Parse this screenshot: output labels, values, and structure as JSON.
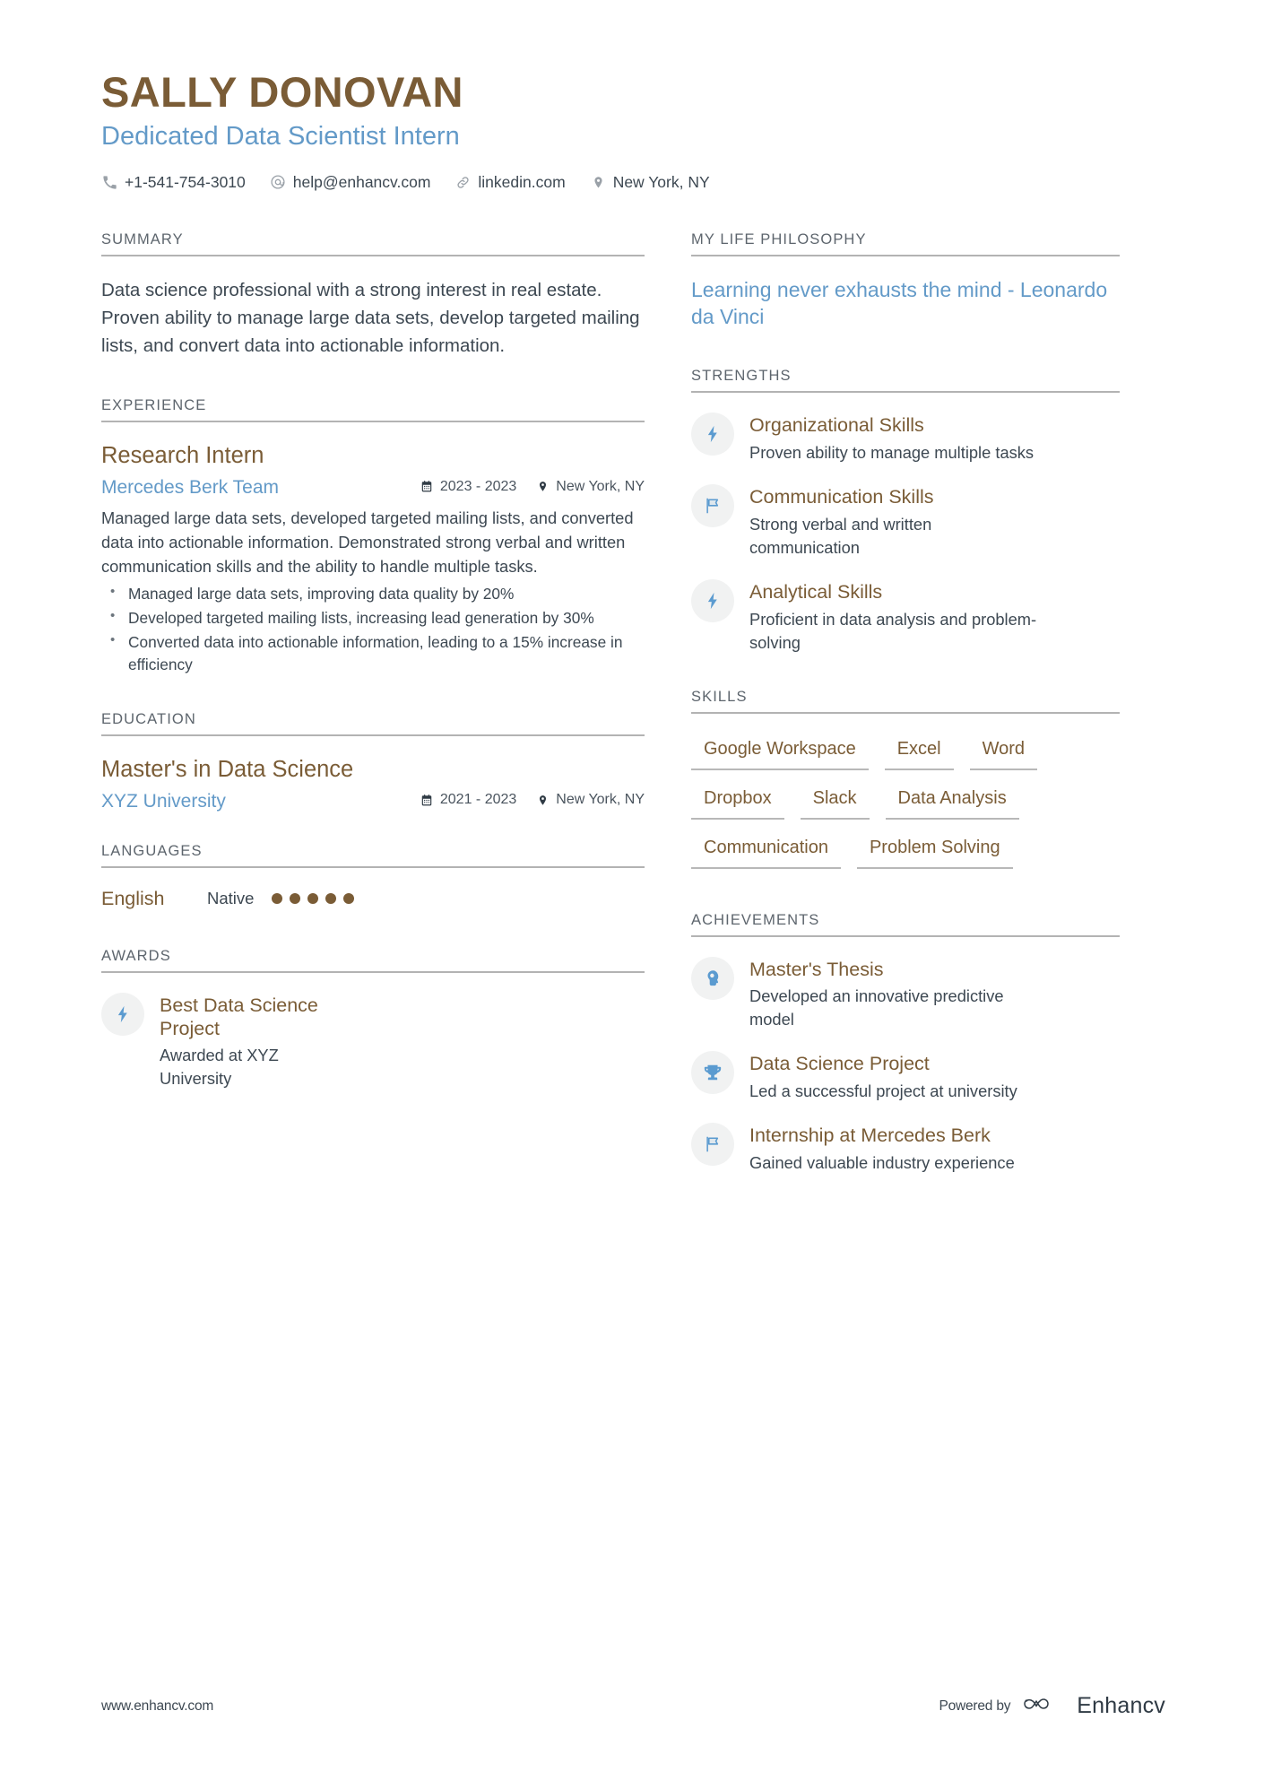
{
  "header": {
    "name": "SALLY DONOVAN",
    "title": "Dedicated Data Scientist Intern",
    "contacts": [
      {
        "icon": "phone-icon",
        "text": "+1-541-754-3010"
      },
      {
        "icon": "email-icon",
        "text": "help@enhancv.com"
      },
      {
        "icon": "link-icon",
        "text": "linkedin.com"
      },
      {
        "icon": "location-pin-icon",
        "text": "New York, NY"
      }
    ]
  },
  "summary": {
    "heading": "SUMMARY",
    "text": "Data science professional with a strong interest in real estate. Proven ability to manage large data sets, develop targeted mailing lists, and convert data into actionable information."
  },
  "experience": {
    "heading": "EXPERIENCE",
    "entries": [
      {
        "title": "Research Intern",
        "organization": "Mercedes Berk Team",
        "date": "2023 - 2023",
        "location": "New York, NY",
        "description": "Managed large data sets, developed targeted mailing lists, and converted data into actionable information. Demonstrated strong verbal and written communication skills and the ability to handle multiple tasks.",
        "bullets": [
          "Managed large data sets, improving data quality by 20%",
          "Developed targeted mailing lists, increasing lead generation by 30%",
          "Converted data into actionable information, leading to a 15% increase in efficiency"
        ]
      }
    ]
  },
  "education": {
    "heading": "EDUCATION",
    "entries": [
      {
        "title": "Master's in Data Science",
        "organization": "XYZ University",
        "date": "2021 - 2023",
        "location": "New York, NY"
      }
    ]
  },
  "languages": {
    "heading": "LANGUAGES",
    "items": [
      {
        "name": "English",
        "level": "Native",
        "filled": 5,
        "total": 5
      }
    ]
  },
  "awards": {
    "heading": "AWARDS",
    "items": [
      {
        "icon": "lightning-bolt-icon",
        "title": "Best Data Science Project",
        "description": "Awarded at XYZ University"
      }
    ]
  },
  "philosophy": {
    "heading": "MY LIFE PHILOSOPHY",
    "quote": "Learning never exhausts the mind - Leonardo da Vinci"
  },
  "strengths": {
    "heading": "STRENGTHS",
    "items": [
      {
        "icon": "lightning-bolt-icon",
        "title": "Organizational Skills",
        "description": "Proven ability to manage multiple tasks"
      },
      {
        "icon": "flag-icon",
        "title": "Communication Skills",
        "description": "Strong verbal and written communication"
      },
      {
        "icon": "lightning-bolt-icon",
        "title": "Analytical Skills",
        "description": "Proficient in data analysis and problem-solving"
      }
    ]
  },
  "skills": {
    "heading": "SKILLS",
    "items": [
      "Google Workspace",
      "Excel",
      "Word",
      "Dropbox",
      "Slack",
      "Data Analysis",
      "Communication",
      "Problem Solving"
    ]
  },
  "achievements": {
    "heading": "ACHIEVEMENTS",
    "items": [
      {
        "icon": "head-idea-icon",
        "title": "Master's Thesis",
        "description": "Developed an innovative predictive model"
      },
      {
        "icon": "trophy-icon",
        "title": "Data Science Project",
        "description": "Led a successful project at university"
      },
      {
        "icon": "flag-icon",
        "title": "Internship at Mercedes Berk",
        "description": "Gained valuable industry experience"
      }
    ]
  },
  "footer": {
    "url": "www.enhancv.com",
    "powered_by": "Powered by",
    "brand": "Enhancv"
  },
  "colors": {
    "accent_brown": "#7a5c36",
    "accent_blue": "#639ac8",
    "icon_blue": "#5b9bd0",
    "text": "#3d4852",
    "rule": "#b3b3b3"
  }
}
